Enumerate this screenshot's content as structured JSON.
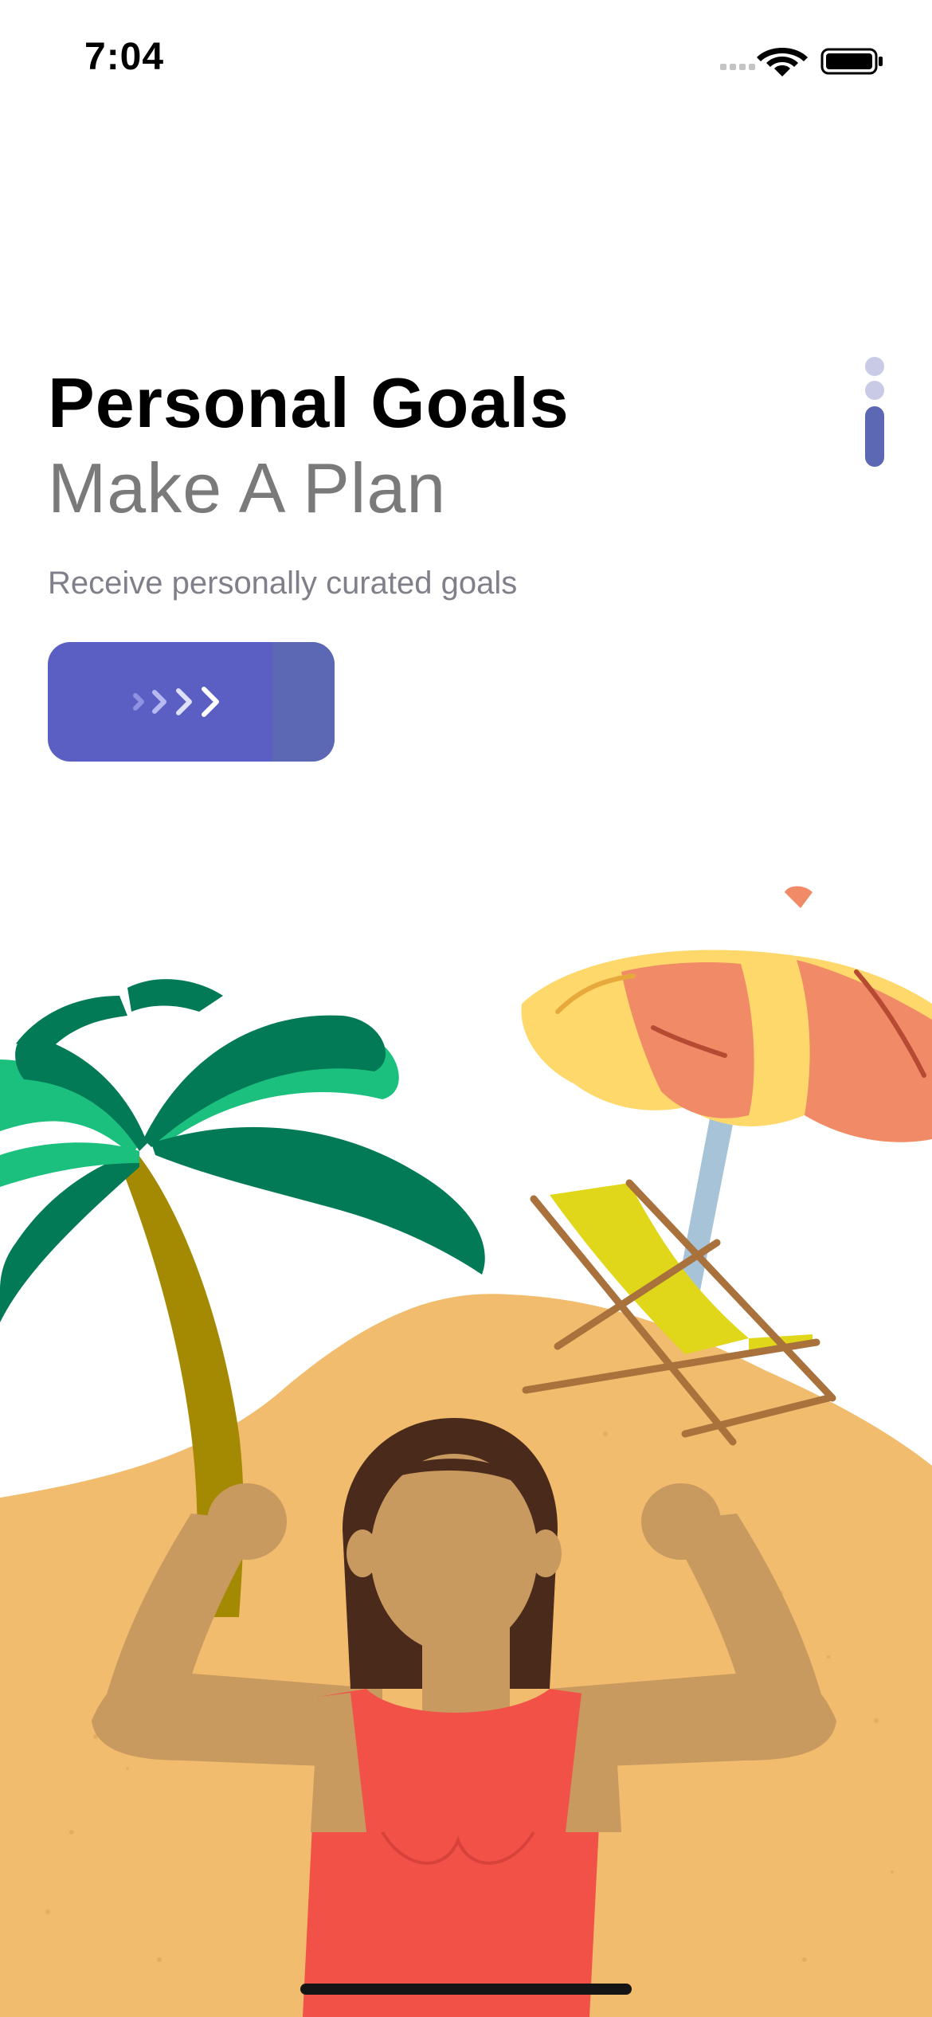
{
  "status_bar": {
    "time": "7:04",
    "icons": [
      "cellular-signal-icon",
      "wifi-icon",
      "battery-icon"
    ]
  },
  "onboarding": {
    "title": "Personal Goals",
    "subtitle": "Make A Plan",
    "description": "Receive personally curated goals",
    "next_button": {
      "icon": "chevrons-right-icon"
    },
    "pager": {
      "total_pages": 3,
      "current_page": 3
    }
  },
  "illustration": {
    "name": "beach-fitness-illustration",
    "colors": {
      "sand": "#f1bc6d",
      "palm_leaf": "#027a56",
      "palm_leaf_highlight": "#1cc07e",
      "palm_trunk": "#a38a02",
      "skin": "#c99a60",
      "hair": "#4a2a1b",
      "swimsuit": "#f15146",
      "umbrella_yellow": "#ffd86b",
      "umbrella_orange": "#f18a66",
      "umbrella_pole": "#a7c3d8",
      "chair_fabric": "#e0d71a",
      "chair_frame": "#a9723d"
    }
  },
  "colors": {
    "accent": "#5b5fc4",
    "pager_active": "#5d68b4",
    "pager_inactive": "#c9cbe6",
    "title_text": "#000000",
    "subtitle_text": "#7a7a7a",
    "description_text": "#80808a"
  }
}
